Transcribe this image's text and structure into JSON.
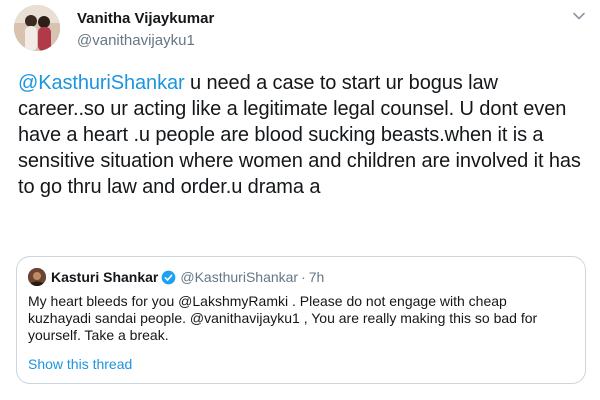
{
  "author": {
    "display_name": "Vanitha Vijaykumar",
    "handle": "@vanithavijayku1",
    "avatar_icon": "user-avatar"
  },
  "tweet": {
    "mention": "@KasthuriShankar",
    "text": " u need a case to start ur bogus law career..so ur acting like a legitimate legal counsel. U dont even have a heart .u people are blood sucking beasts.when it is a sensitive situation where women and children are involved it has to go thru law and order.u drama a",
    "more_icon": "chevron-down-icon"
  },
  "quoted_tweet": {
    "display_name": "Kasturi Shankar",
    "verified_icon": "verified-badge-icon",
    "handle": "@KasthuriShankar",
    "separator": "·",
    "time": "7h",
    "text": "My heart bleeds for you @LakshmyRamki  . Please  do not  engage with cheap kuzhayadi sandai people.  @vanithavijayku1 , You are really making this so bad for yourself.  Take a break.",
    "show_thread_label": "Show this thread"
  },
  "colors": {
    "link": "#1b95e0",
    "text": "#14171a",
    "secondary": "#657786",
    "border": "#ccd6dd",
    "verified": "#1da1f2"
  }
}
